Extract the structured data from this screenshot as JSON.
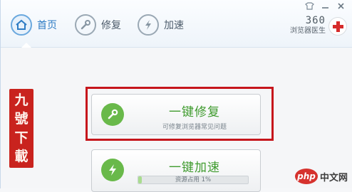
{
  "nav": {
    "items": [
      {
        "label": "首页",
        "icon": "home-icon"
      },
      {
        "label": "修复",
        "icon": "wrench-icon"
      },
      {
        "label": "加速",
        "icon": "lightning-icon"
      }
    ]
  },
  "window": {
    "icons": [
      "shirt-icon",
      "minimize-icon",
      "close-icon"
    ]
  },
  "brand": {
    "number": "360",
    "name": "浏览器医生",
    "logo": "red-cross-icon"
  },
  "seal": {
    "chars": [
      "九",
      "號",
      "下",
      "載"
    ]
  },
  "actions": {
    "repair": {
      "title": "一键修复",
      "subtitle": "可修复浏览器常见问题",
      "icon": "wrench-icon"
    },
    "speed": {
      "title": "一键加速",
      "usage_label": "资源占用",
      "usage_value": "1%",
      "usage_fraction": 0.01,
      "icon": "lightning-icon"
    }
  },
  "watermark": {
    "logo": "php",
    "text": "中文网"
  },
  "colors": {
    "accent": "#2d7bc4",
    "green": "#3f9b2e",
    "highlight": "#c6161c",
    "seal": "#c9231e"
  }
}
